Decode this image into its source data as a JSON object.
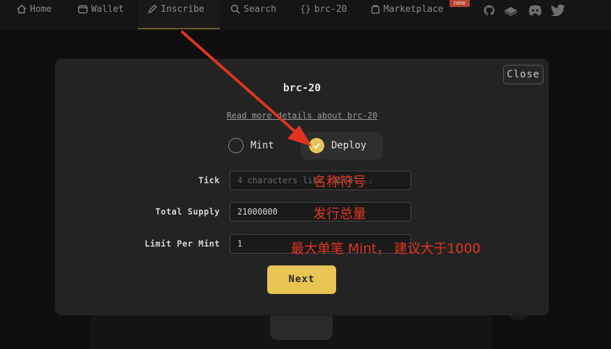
{
  "nav": {
    "items": [
      {
        "label": "Home",
        "icon": "home-icon"
      },
      {
        "label": "Wallet",
        "icon": "wallet-icon"
      },
      {
        "label": "Inscribe",
        "icon": "pencil-icon"
      },
      {
        "label": "Search",
        "icon": "search-icon"
      },
      {
        "label": "brc-20",
        "icon": "braces-icon"
      },
      {
        "label": "Marketplace",
        "icon": "bag-icon"
      }
    ],
    "active": "Inscribe",
    "badge": "new",
    "social": [
      "github-icon",
      "gitbook-icon",
      "discord-icon",
      "twitter-icon"
    ]
  },
  "modal": {
    "close_label": "Close",
    "title": "brc-20",
    "read_more": "Read more details about brc-20",
    "options": {
      "mint": "Mint",
      "deploy": "Deploy",
      "selected": "Deploy"
    },
    "fields": {
      "tick_label": "Tick",
      "tick_placeholder": "4 characters like \"abcd\"...",
      "supply_label": "Total Supply",
      "supply_value": "21000000",
      "limit_label": "Limit Per Mint",
      "limit_value": "1"
    },
    "next_label": "Next"
  },
  "annotations": {
    "tick_note": "名称符号",
    "supply_note": "发行总量",
    "limit_note": "最大单笔 Mint， 建议大于1000",
    "color": "#e2341f"
  },
  "colors": {
    "accent": "#e8c455",
    "modal_bg": "#232323",
    "page_bg": "#0e0e0e"
  }
}
